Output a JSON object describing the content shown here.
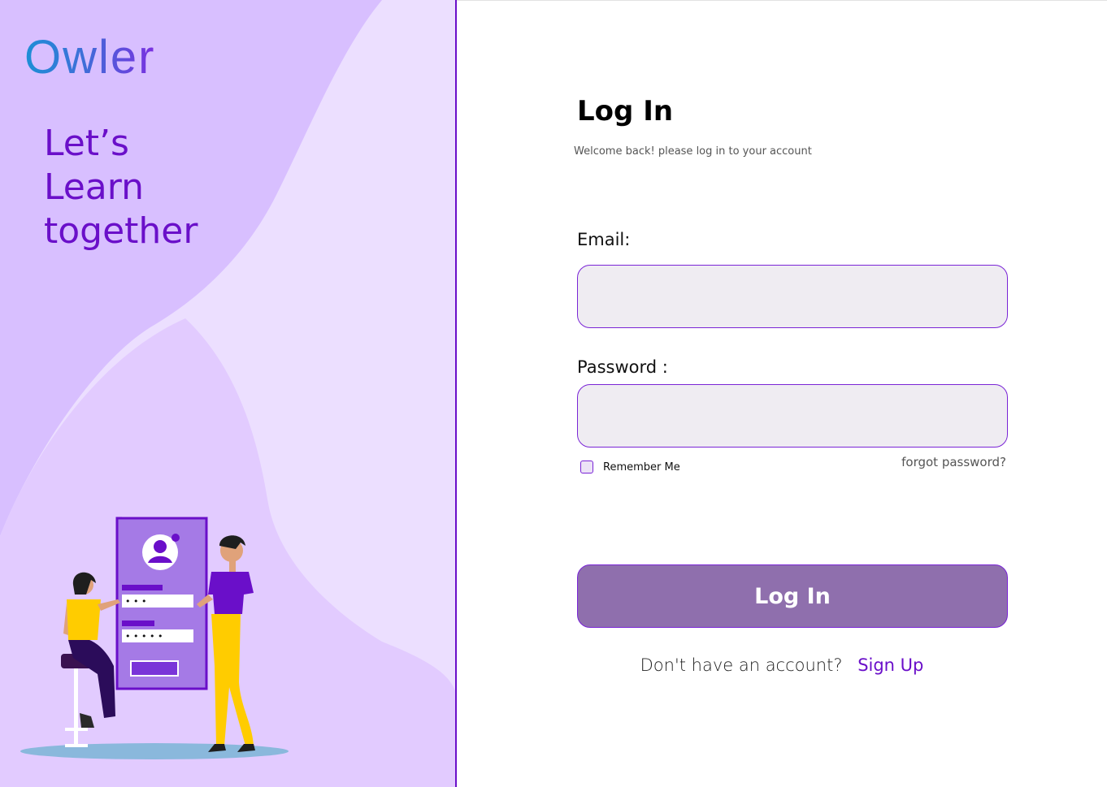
{
  "brand": {
    "logo": "Owler"
  },
  "tagline": {
    "lines": [
      "Let’s",
      "Learn",
      "together"
    ]
  },
  "illustration": {
    "password_dots_1": "• • •",
    "password_dots_2": "• • • • •"
  },
  "form": {
    "title": "Log In",
    "subtitle": "Welcome back! please log in to your account",
    "email_label": "Email:",
    "email_value": "",
    "password_label": "Password :",
    "password_value": "",
    "remember_label": "Remember Me",
    "remember_checked": false,
    "forgot_label": "forgot password?",
    "submit_label": "Log In",
    "signup_prompt": "Don't have an account?",
    "signup_link": "Sign Up"
  },
  "colors": {
    "accent": "#6a0fc9",
    "left_bg_light": "#ecdfff",
    "left_bg_mid": "#dcc3ff",
    "button_fill": "#8f6fad",
    "input_fill": "#efecf2"
  }
}
